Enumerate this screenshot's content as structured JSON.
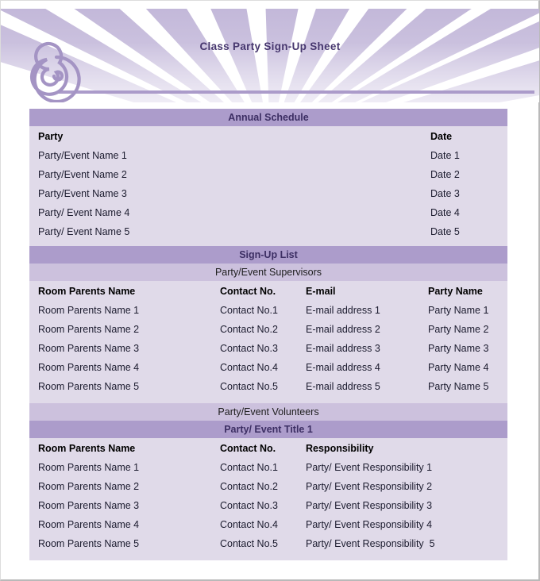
{
  "document": {
    "title": "Class Party Sign-Up Sheet",
    "logo_icon": "spiral-icon",
    "accent_dark": "#ac9ccb",
    "accent_light": "#ccc1dd",
    "body_bg": "#e0dae9",
    "title_color": "#46366e"
  },
  "annual_schedule": {
    "section_title": "Annual Schedule",
    "columns": [
      "Party",
      "Date"
    ],
    "rows": [
      {
        "party": "Party/Event Name 1",
        "date": "Date 1"
      },
      {
        "party": "Party/Event Name 2",
        "date": "Date 2"
      },
      {
        "party": "Party/Event Name 3",
        "date": "Date 3"
      },
      {
        "party": "Party/ Event Name 4",
        "date": "Date 4"
      },
      {
        "party": "Party/ Event Name 5",
        "date": "Date 5"
      }
    ]
  },
  "signup_list": {
    "section_title": "Sign-Up List",
    "supervisors": {
      "subsection_title": "Party/Event Supervisors",
      "columns": [
        "Room Parents Name",
        "Contact No.",
        "E-mail",
        "Party Name"
      ],
      "rows": [
        {
          "name": "Room Parents Name 1",
          "contact": "Contact No.1",
          "email": "E-mail address 1",
          "party": "Party Name 1"
        },
        {
          "name": "Room Parents Name 2",
          "contact": "Contact No.2",
          "email": "E-mail address 2",
          "party": "Party Name 2"
        },
        {
          "name": "Room Parents Name 3",
          "contact": "Contact No.3",
          "email": "E-mail address 3",
          "party": "Party Name 3"
        },
        {
          "name": "Room Parents Name 4",
          "contact": "Contact No.4",
          "email": "E-mail address 4",
          "party": "Party Name 4"
        },
        {
          "name": "Room Parents Name 5",
          "contact": "Contact No.5",
          "email": "E-mail address 5",
          "party": "Party Name 5"
        }
      ]
    },
    "volunteers": {
      "subsection_title": "Party/Event Volunteers",
      "event_title": "Party/ Event Title 1",
      "columns": [
        "Room Parents Name",
        "Contact No.",
        "Responsibility"
      ],
      "rows": [
        {
          "name": "Room Parents Name 1",
          "contact": "Contact No.1",
          "responsibility": "Party/ Event Responsibility 1"
        },
        {
          "name": "Room Parents Name 2",
          "contact": "Contact No.2",
          "responsibility": "Party/ Event Responsibility 2"
        },
        {
          "name": "Room Parents Name 3",
          "contact": "Contact No.3",
          "responsibility": "Party/ Event Responsibility 3"
        },
        {
          "name": "Room Parents Name 4",
          "contact": "Contact No.4",
          "responsibility": "Party/ Event Responsibility 4"
        },
        {
          "name": "Room Parents Name 5",
          "contact": "Contact No.5",
          "responsibility": "Party/ Event Responsibility  5"
        }
      ]
    }
  }
}
